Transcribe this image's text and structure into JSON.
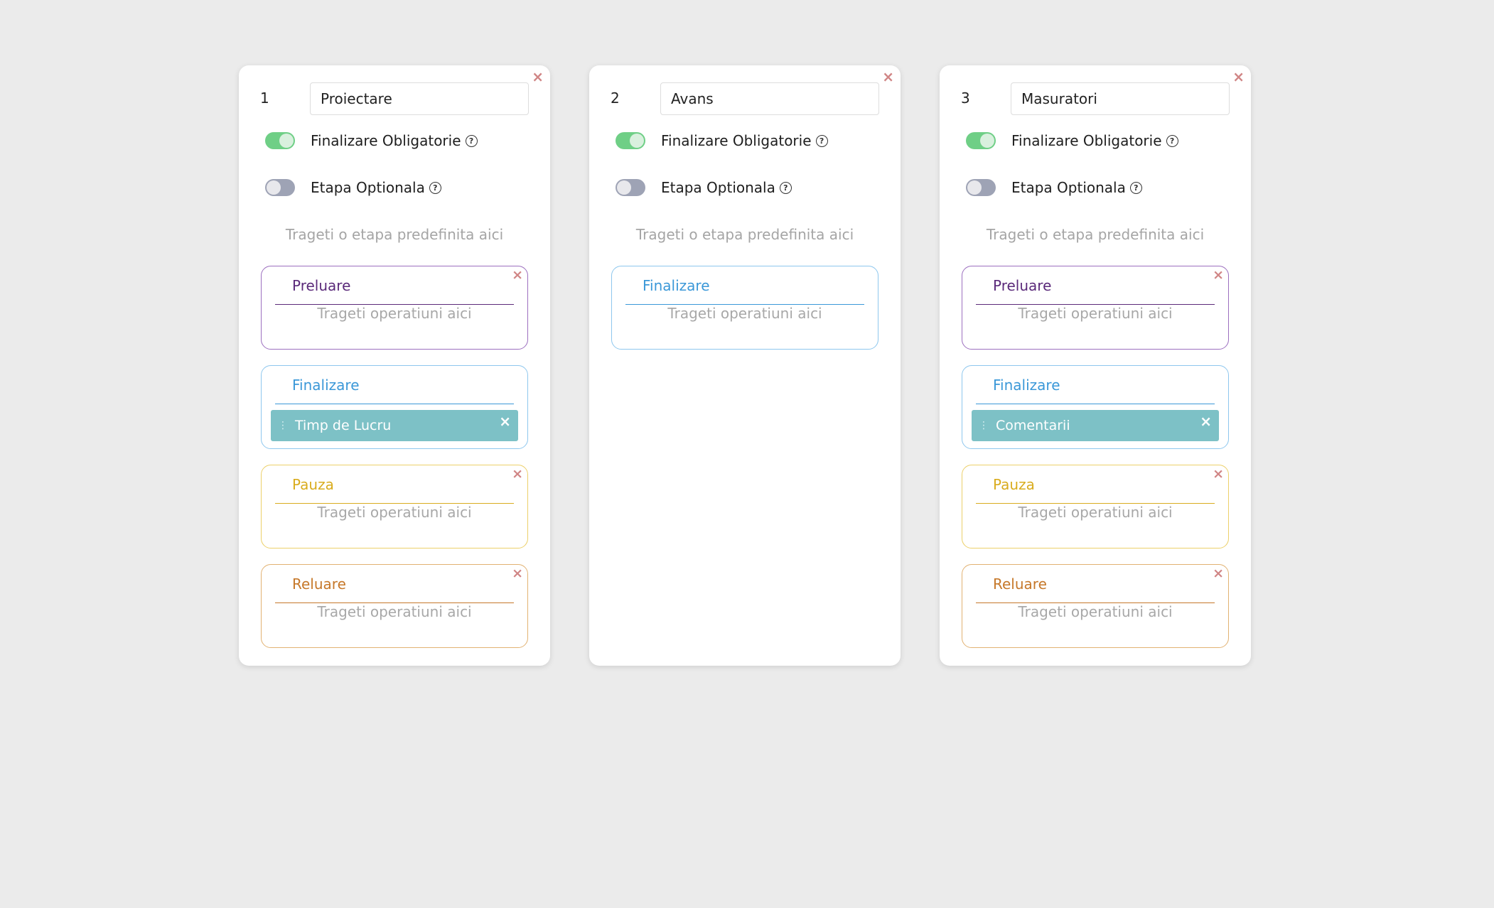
{
  "colors": {
    "background": "#ebebeb",
    "close": "#d08585",
    "toggle_on": "#6fcf86",
    "toggle_off": "#9ea3b5",
    "preluare": "#5b2a7a",
    "preluare_border": "#9c6fbf",
    "finalizare": "#3b98d8",
    "finalizare_border": "#8ec7ee",
    "pauza": "#d9ac1e",
    "pauza_border": "#ecd06a",
    "reluare": "#c6782a",
    "reluare_border": "#e2b272",
    "operation_chip": "#7dc1c6"
  },
  "labels": {
    "finalizare_obligatorie": "Finalizare Obligatorie",
    "etapa_optionala": "Etapa Optionala",
    "drop_stage_hint": "Trageti o etapa predefinita aici",
    "drop_operation_hint": "Trageti operatiuni aici",
    "close_glyph": "×",
    "help_glyph": "?",
    "handle_glyph": "⋮"
  },
  "stages": [
    {
      "number": "1",
      "name": "Proiectare",
      "finalizare_obligatorie": true,
      "etapa_optionala": false,
      "events": [
        {
          "key": "preluare",
          "title": "Preluare",
          "operations": []
        },
        {
          "key": "finalizare",
          "title": "Finalizare",
          "operations": [
            "Timp de Lucru"
          ]
        },
        {
          "key": "pauza",
          "title": "Pauza",
          "operations": []
        },
        {
          "key": "reluare",
          "title": "Reluare",
          "operations": []
        }
      ]
    },
    {
      "number": "2",
      "name": "Avans",
      "finalizare_obligatorie": true,
      "etapa_optionala": false,
      "events": [
        {
          "key": "finalizare",
          "title": "Finalizare",
          "operations": []
        }
      ]
    },
    {
      "number": "3",
      "name": "Masuratori",
      "finalizare_obligatorie": true,
      "etapa_optionala": false,
      "events": [
        {
          "key": "preluare",
          "title": "Preluare",
          "operations": []
        },
        {
          "key": "finalizare",
          "title": "Finalizare",
          "operations": [
            "Comentarii"
          ]
        },
        {
          "key": "pauza",
          "title": "Pauza",
          "operations": []
        },
        {
          "key": "reluare",
          "title": "Reluare",
          "operations": []
        }
      ]
    }
  ]
}
